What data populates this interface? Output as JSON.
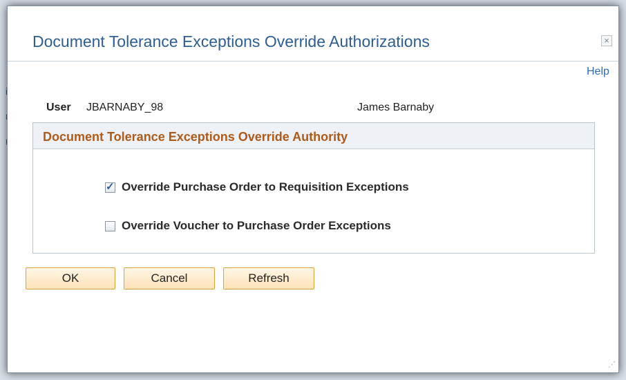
{
  "dialog": {
    "title": "Document Tolerance Exceptions Override Authorizations",
    "close_label": "×",
    "help_label": "Help"
  },
  "user": {
    "label": "User",
    "id": "JBARNABY_98",
    "name": "James Barnaby"
  },
  "section": {
    "title": "Document Tolerance Exceptions Override Authority",
    "options": [
      {
        "label": "Override Purchase Order to Requisition Exceptions",
        "checked": true
      },
      {
        "label": "Override Voucher to Purchase Order Exceptions",
        "checked": false
      }
    ]
  },
  "buttons": {
    "ok": "OK",
    "cancel": "Cancel",
    "refresh": "Refresh"
  },
  "colors": {
    "title": "#2d5d91",
    "section_title": "#b05a19",
    "link": "#2b6cb0",
    "button_border": "#d9a23e"
  },
  "background": {
    "letters": [
      "i",
      "r",
      "r"
    ]
  }
}
